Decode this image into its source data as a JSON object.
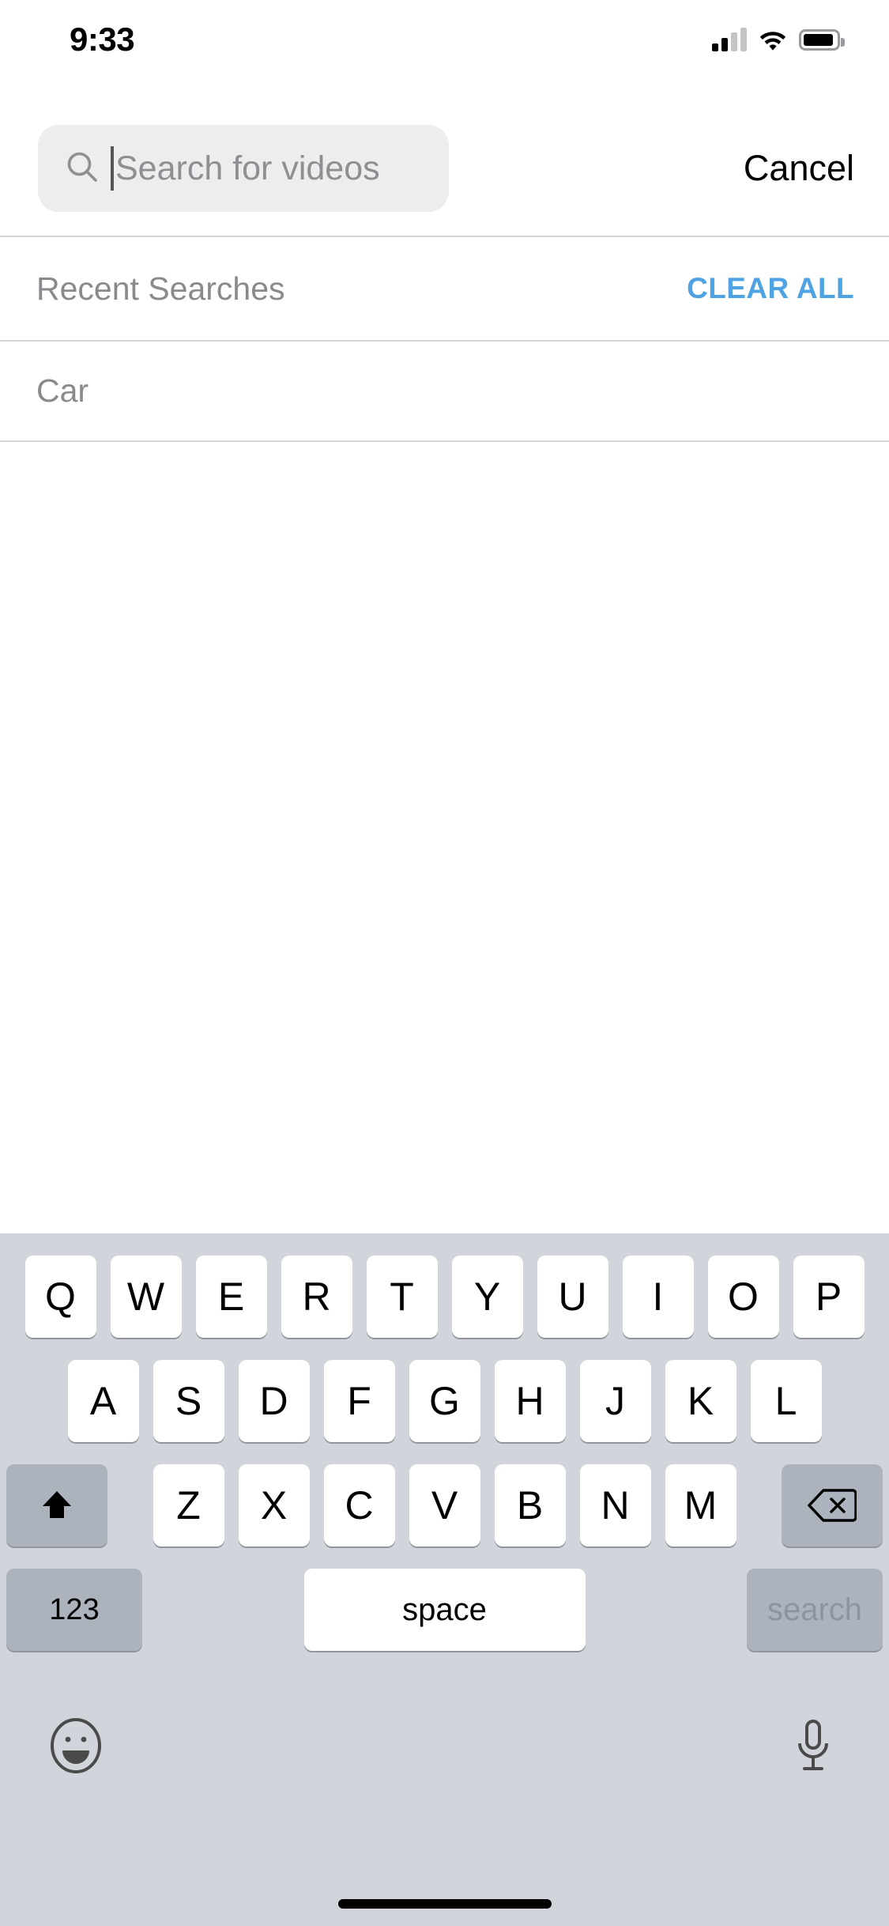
{
  "status_bar": {
    "time": "9:33",
    "signal_icon": "cellular-signal-icon",
    "wifi_icon": "wifi-icon",
    "battery_icon": "battery-icon",
    "signal_bars_filled": 2,
    "signal_bars_total": 4
  },
  "search": {
    "icon": "search-icon",
    "value": "",
    "placeholder": "Search for videos",
    "cancel_label": "Cancel",
    "caret_visible": true
  },
  "recent": {
    "header_label": "Recent Searches",
    "clear_all_label": "CLEAR ALL",
    "items": [
      {
        "label": "Car"
      }
    ]
  },
  "keyboard": {
    "row1": [
      "Q",
      "W",
      "E",
      "R",
      "T",
      "Y",
      "U",
      "I",
      "O",
      "P"
    ],
    "row2": [
      "A",
      "S",
      "D",
      "F",
      "G",
      "H",
      "J",
      "K",
      "L"
    ],
    "row3_letters": [
      "Z",
      "X",
      "C",
      "V",
      "B",
      "N",
      "M"
    ],
    "shift_key": "shift-icon",
    "backspace_key": "backspace-icon",
    "numbers_label": "123",
    "space_label": "space",
    "return_label": "search",
    "emoji_key": "emoji-icon",
    "dictation_key": "microphone-icon"
  },
  "colors": {
    "accent_blue": "#4fa3e3",
    "search_field_bg": "#ededed",
    "keyboard_bg": "#d1d5db",
    "modifier_key_bg": "#adb3bc",
    "secondary_text": "#8a8a8e"
  }
}
